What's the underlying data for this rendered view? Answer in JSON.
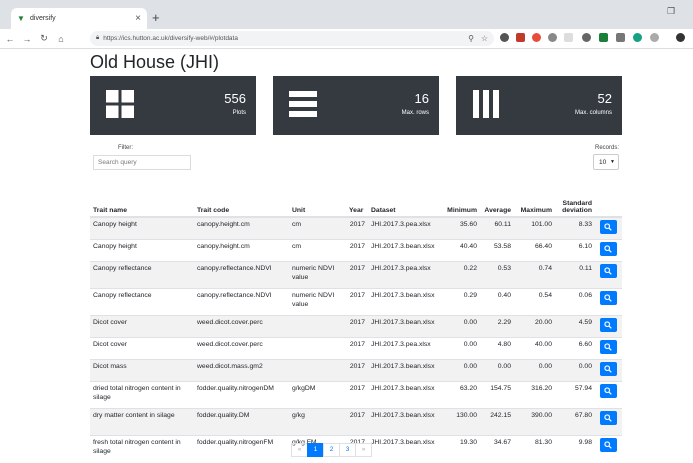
{
  "browser": {
    "tab_title": "diversify",
    "url": "https://ics.hutton.ac.uk/diversify-web/#/plotdata"
  },
  "page_title": "Old House (JHI)",
  "cards": [
    {
      "value": "556",
      "label": "Plots"
    },
    {
      "value": "16",
      "label": "Max. rows"
    },
    {
      "value": "52",
      "label": "Max. columns"
    }
  ],
  "filter": {
    "label": "Filter:",
    "placeholder": "Search query"
  },
  "records": {
    "label": "Records:",
    "value": "10"
  },
  "table": {
    "headers": {
      "trait_name": "Trait name",
      "trait_code": "Trait code",
      "unit": "Unit",
      "year": "Year",
      "dataset": "Dataset",
      "minimum": "Minimum",
      "average": "Average",
      "maximum": "Maximum",
      "std": "Standard deviation"
    },
    "rows": [
      {
        "name": "Canopy height",
        "code": "canopy.height.cm",
        "unit": "cm",
        "year": "2017",
        "dataset": "JHI.2017.3.pea.xlsx",
        "min": "35.60",
        "avg": "60.11",
        "max": "101.00",
        "sd": "8.33"
      },
      {
        "name": "Canopy height",
        "code": "canopy.height.cm",
        "unit": "cm",
        "year": "2017",
        "dataset": "JHI.2017.3.bean.xlsx",
        "min": "40.40",
        "avg": "53.58",
        "max": "66.40",
        "sd": "6.10"
      },
      {
        "name": "Canopy reflectance",
        "code": "canopy.reflectance.NDVI",
        "unit": "numeric NDVI value",
        "year": "2017",
        "dataset": "JHI.2017.3.pea.xlsx",
        "min": "0.22",
        "avg": "0.53",
        "max": "0.74",
        "sd": "0.11"
      },
      {
        "name": "Canopy reflectance",
        "code": "canopy.reflectance.NDVI",
        "unit": "numeric NDVI value",
        "year": "2017",
        "dataset": "JHI.2017.3.bean.xlsx",
        "min": "0.29",
        "avg": "0.40",
        "max": "0.54",
        "sd": "0.06"
      },
      {
        "name": "Dicot cover",
        "code": "weed.dicot.cover.perc",
        "unit": "",
        "year": "2017",
        "dataset": "JHI.2017.3.bean.xlsx",
        "min": "0.00",
        "avg": "2.29",
        "max": "20.00",
        "sd": "4.59"
      },
      {
        "name": "Dicot cover",
        "code": "weed.dicot.cover.perc",
        "unit": "",
        "year": "2017",
        "dataset": "JHI.2017.3.pea.xlsx",
        "min": "0.00",
        "avg": "4.80",
        "max": "40.00",
        "sd": "6.60"
      },
      {
        "name": "Dicot mass",
        "code": "weed.dicot.mass.gm2",
        "unit": "",
        "year": "2017",
        "dataset": "JHI.2017.3.bean.xlsx",
        "min": "0.00",
        "avg": "0.00",
        "max": "0.00",
        "sd": "0.00"
      },
      {
        "name": "dried total nitrogen content in silage",
        "code": "fodder.quality.nitrogenDM",
        "unit": "g/kgDM",
        "year": "2017",
        "dataset": "JHI.2017.3.bean.xlsx",
        "min": "63.20",
        "avg": "154.75",
        "max": "316.20",
        "sd": "57.94"
      },
      {
        "name": "dry matter content in silage",
        "code": "fodder.quality.DM",
        "unit": "g/kg",
        "year": "2017",
        "dataset": "JHI.2017.3.bean.xlsx",
        "min": "130.00",
        "avg": "242.15",
        "max": "390.00",
        "sd": "67.80"
      },
      {
        "name": "fresh total nitrogen content in silage",
        "code": "fodder.quality.nitrogenFM",
        "unit": "g/kg FM",
        "year": "2017",
        "dataset": "JHI.2017.3.bean.xlsx",
        "min": "19.30",
        "avg": "34.67",
        "max": "81.30",
        "sd": "9.98"
      }
    ]
  },
  "pagination": {
    "prev": "«",
    "pages": [
      "1",
      "2",
      "3"
    ],
    "next": "»",
    "active": "1"
  }
}
